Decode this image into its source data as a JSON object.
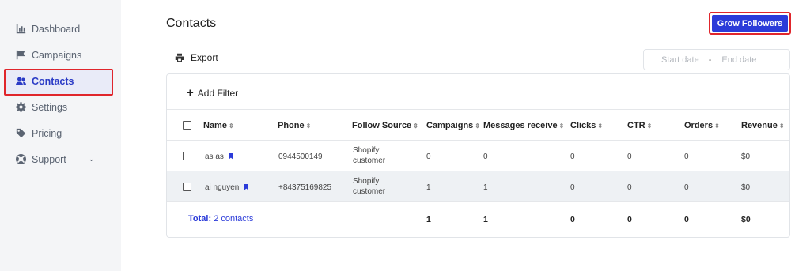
{
  "sidebar": {
    "items": [
      {
        "label": "Dashboard",
        "icon": "chart-icon"
      },
      {
        "label": "Campaigns",
        "icon": "flag-icon"
      },
      {
        "label": "Contacts",
        "icon": "users-icon"
      },
      {
        "label": "Settings",
        "icon": "gear-icon"
      },
      {
        "label": "Pricing",
        "icon": "tag-icon"
      },
      {
        "label": "Support",
        "icon": "lifebuoy-icon",
        "chevron": "⌄"
      }
    ]
  },
  "header": {
    "title": "Contacts",
    "grow_label": "Grow Followers",
    "export_label": "Export"
  },
  "date_range": {
    "start_placeholder": "Start date",
    "separator": "-",
    "end_placeholder": "End date"
  },
  "filter": {
    "add_label": "Add Filter"
  },
  "table": {
    "columns": [
      "Name",
      "Phone",
      "Follow Source",
      "Campaigns",
      "Messages receive",
      "Clicks",
      "CTR",
      "Orders",
      "Revenue"
    ],
    "rows": [
      {
        "name": "as as",
        "phone": "0944500149",
        "source": "Shopify customer",
        "campaigns": "0",
        "messages": "0",
        "clicks": "0",
        "ctr": "0",
        "orders": "0",
        "revenue": "$0"
      },
      {
        "name": "ai nguyen",
        "phone": "+84375169825",
        "source": "Shopify customer",
        "campaigns": "1",
        "messages": "1",
        "clicks": "0",
        "ctr": "0",
        "orders": "0",
        "revenue": "$0"
      }
    ],
    "total": {
      "label": "Total:",
      "count": "2 contacts",
      "campaigns": "1",
      "messages": "1",
      "clicks": "0",
      "ctr": "0",
      "orders": "0",
      "revenue": "$0"
    }
  },
  "colors": {
    "accent": "#2b3bd9",
    "highlight": "#e0262c"
  }
}
